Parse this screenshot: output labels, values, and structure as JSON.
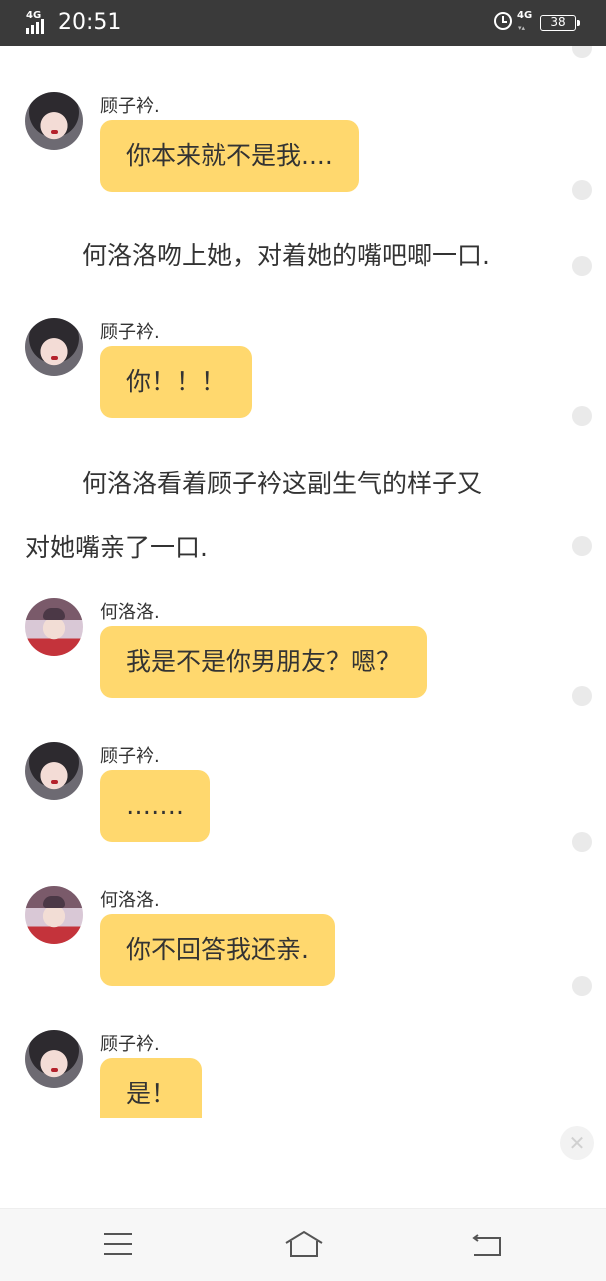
{
  "status_bar": {
    "network_left": "4G",
    "time": "20:51",
    "network_right": "4G",
    "network_right_sub": "▾▴",
    "battery": "38"
  },
  "messages": [
    {
      "sender": "顾子衿.",
      "text": "你本来就不是我...."
    },
    {
      "narration": "何洛洛吻上她，对着她的嘴吧唧一口."
    },
    {
      "sender": "顾子衿.",
      "text": "你！！！"
    },
    {
      "narration_line1": "何洛洛看着顾子衿这副生气的样子又",
      "narration_line2": "对她嘴亲了一口."
    },
    {
      "sender": "何洛洛.",
      "text": "我是不是你男朋友？嗯？"
    },
    {
      "sender": "顾子衿.",
      "text": "……."
    },
    {
      "sender": "何洛洛.",
      "text": "你不回答我还亲."
    },
    {
      "sender": "顾子衿.",
      "text": "是！"
    }
  ],
  "close_icon": "✕",
  "nav": {
    "menu_icon": "menu-icon",
    "home_icon": "home-icon",
    "back_icon": "back-icon"
  }
}
